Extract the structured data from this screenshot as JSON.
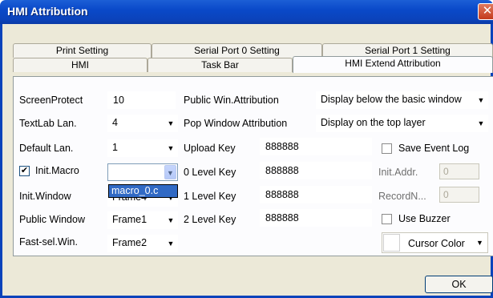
{
  "window": {
    "title": "HMI Attribution",
    "close_glyph": "✕"
  },
  "tabs_back": [
    "Print Setting",
    "Serial Port 0 Setting",
    "Serial Port 1 Setting"
  ],
  "tabs_front": [
    "HMI",
    "Task Bar",
    "HMI Extend Attribution"
  ],
  "active_tab": "HMI Extend Attribution",
  "left": {
    "screen_protect_label": "ScreenProtect",
    "screen_protect_value": "10",
    "textlab_label": "TextLab Lan.",
    "textlab_value": "4",
    "default_lan_label": "Default Lan.",
    "default_lan_value": "1",
    "init_macro_label": "Init.Macro",
    "init_macro_checked": true,
    "init_macro_value": "",
    "init_macro_dropdown_item": "macro_0.c",
    "init_window_label": "Init.Window",
    "init_window_value": "Frame4",
    "public_window_label": "Public Window",
    "public_window_value": "Frame1",
    "fast_sel_label": "Fast-sel.Win.",
    "fast_sel_value": "Frame2"
  },
  "middle": {
    "public_win_attr_label": "Public Win.Attribution",
    "pop_window_attr_label": "Pop Window Attribution",
    "upload_key_label": "Upload Key",
    "upload_key_value": "888888",
    "level0_label": "0 Level Key",
    "level0_value": "888888",
    "level1_label": "1 Level Key",
    "level1_value": "888888",
    "level2_label": "2 Level Key",
    "level2_value": "888888"
  },
  "right": {
    "public_win_attr_value": "Display below the basic window",
    "pop_window_attr_value": "Display on the top layer",
    "save_event_log_label": "Save Event Log",
    "save_event_log_checked": false,
    "init_addr_label": "Init.Addr.",
    "init_addr_value": "0",
    "record_label": "RecordN...",
    "record_value": "0",
    "use_buzzer_label": "Use Buzzer",
    "use_buzzer_checked": false,
    "cursor_color_label": "Cursor Color",
    "cursor_color_value": "#ffffff"
  },
  "ok_label": "OK",
  "dropdown_arrow_glyph": "▼",
  "check_glyph": "✔"
}
